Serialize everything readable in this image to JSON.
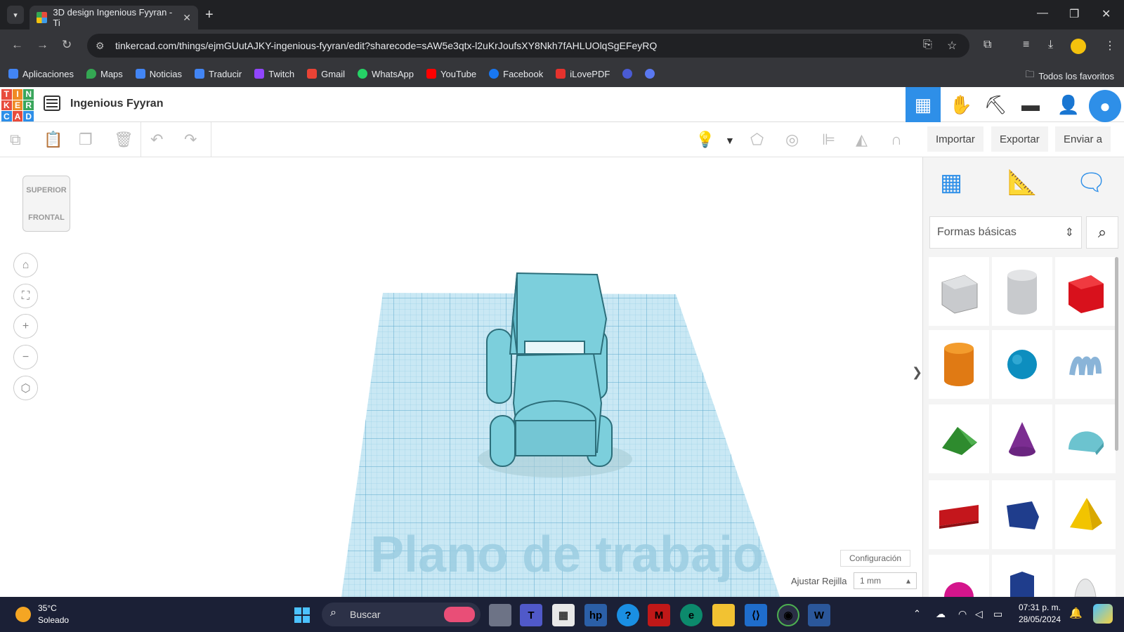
{
  "browser": {
    "tab_title": "3D design Ingenious Fyyran - Ti",
    "url": "tinkercad.com/things/ejmGUutAJKY-ingenious-fyyran/edit?sharecode=sAW5e3qtx-l2uKrJoufsXY8Nkh7fAHLUOlqSgEFeyRQ",
    "bookmarks": [
      {
        "label": "Aplicaciones",
        "color": "#4285f4"
      },
      {
        "label": "Maps",
        "color": "#34a853"
      },
      {
        "label": "Noticias",
        "color": "#4285f4"
      },
      {
        "label": "Traducir",
        "color": "#4285f4"
      },
      {
        "label": "Twitch",
        "color": "#9146ff"
      },
      {
        "label": "Gmail",
        "color": "#ea4335"
      },
      {
        "label": "WhatsApp",
        "color": "#25d366"
      },
      {
        "label": "YouTube",
        "color": "#ff0000"
      },
      {
        "label": "Facebook",
        "color": "#1877f2"
      },
      {
        "label": "iLovePDF",
        "color": "#e5322d"
      }
    ],
    "all_favorites": "Todos los favoritos"
  },
  "app": {
    "logo_letters": [
      "T",
      "I",
      "N",
      "K",
      "E",
      "R",
      "C",
      "A",
      "D"
    ],
    "logo_colors": [
      "#e84c3d",
      "#f08a24",
      "#3aa65c",
      "#e84c3d",
      "#f08a24",
      "#3aa65c",
      "#2e8fe8",
      "#e84c3d",
      "#2e8fe8"
    ],
    "design_name": "Ingenious Fyyran",
    "accent": "#2e8fe8"
  },
  "toolbar": {
    "import": "Importar",
    "export": "Exportar",
    "send": "Enviar a"
  },
  "viewcube": {
    "top": "SUPERIOR",
    "front": "FRONTAL"
  },
  "workspace": {
    "plane_label": "Plano de trabajo",
    "config": "Configuración",
    "snap_label": "Ajustar Rejilla",
    "snap_value": "1 mm"
  },
  "panel": {
    "shape_category": "Formas básicas"
  },
  "taskbar": {
    "temperature": "35°C",
    "weather": "Soleado",
    "search": "Buscar",
    "time": "07:31 p. m.",
    "date": "28/05/2024"
  }
}
